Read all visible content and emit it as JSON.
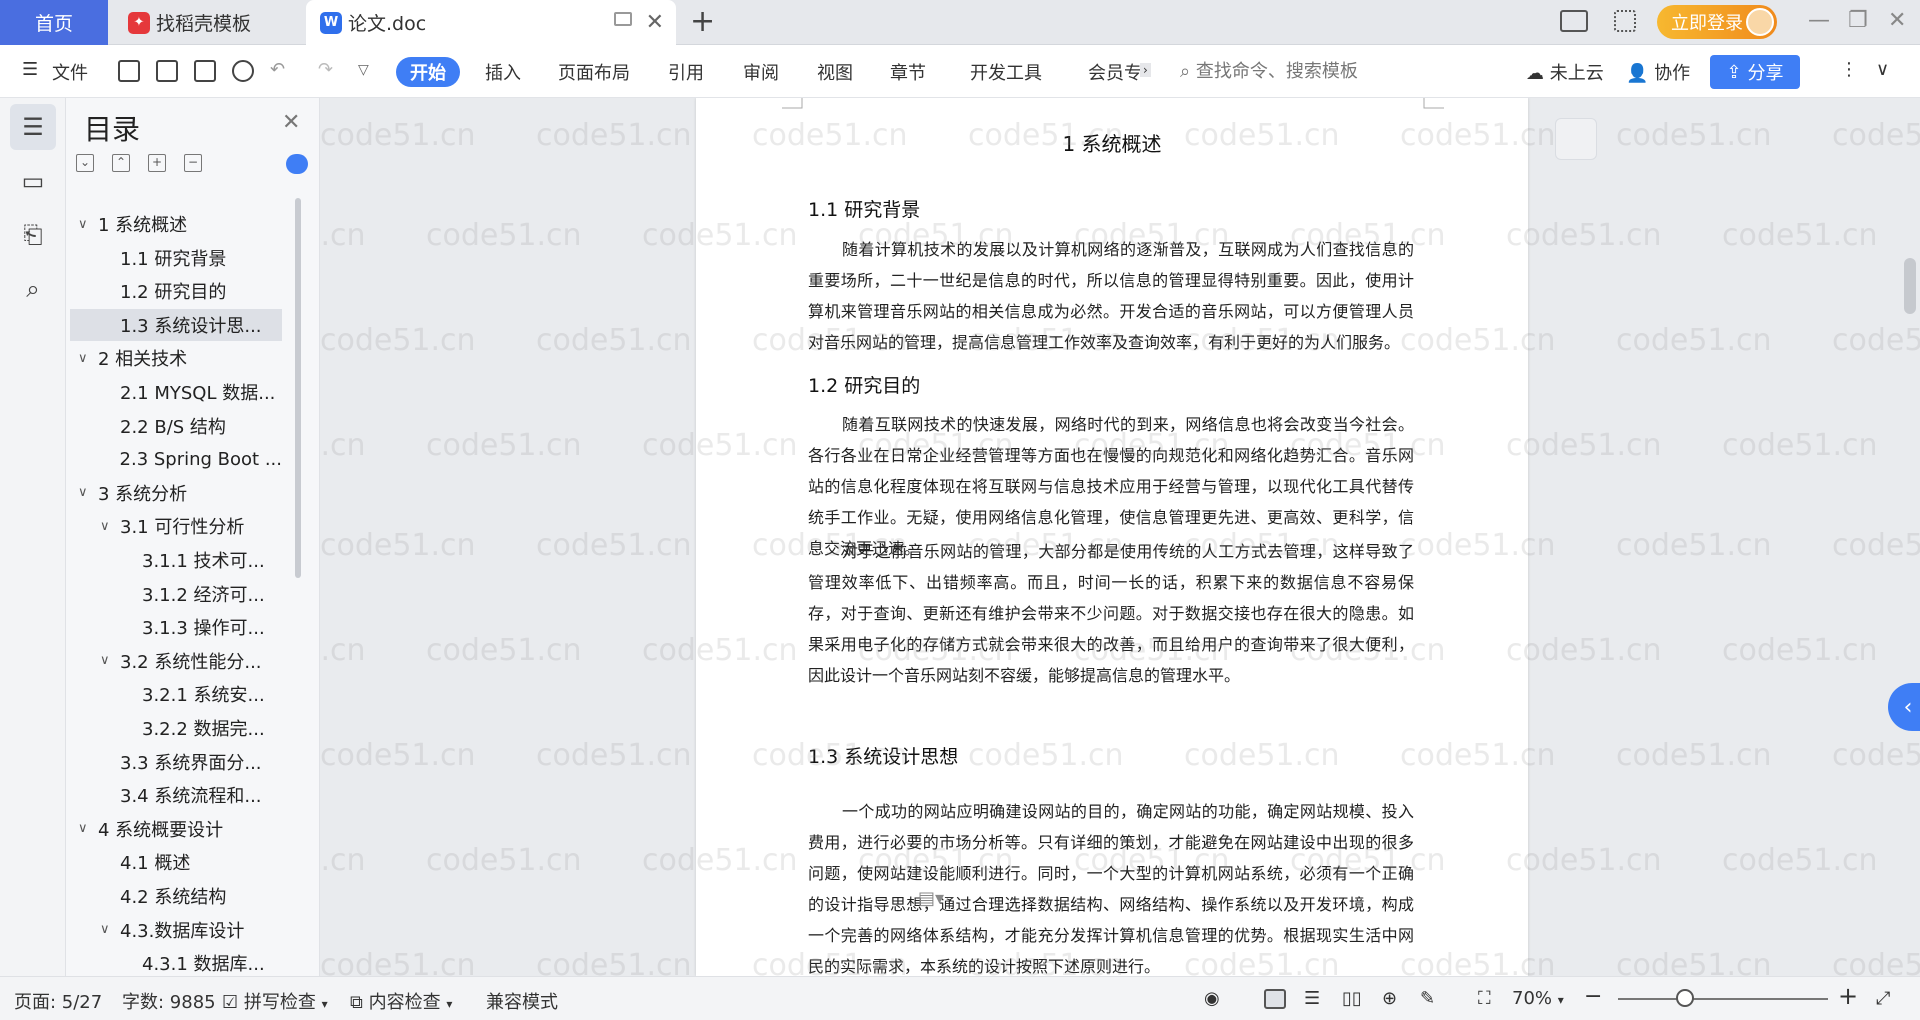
{
  "tabs": {
    "home": "首页",
    "template": "找稻壳模板",
    "doc": "论文.doc",
    "login": "立即登录"
  },
  "ribbon": {
    "file": "文件",
    "start": "开始",
    "menus": [
      "插入",
      "页面布局",
      "引用",
      "审阅",
      "视图",
      "章节",
      "开发工具",
      "会员专"
    ],
    "search_placeholder": "查找命令、搜索模板",
    "cloud": "未上云",
    "collab": "协作",
    "share": "分享"
  },
  "toc": {
    "title": "目录",
    "items": [
      {
        "label": "1 系统概述",
        "level": 0,
        "expanded": true
      },
      {
        "label": "1.1  研究背景",
        "level": 1
      },
      {
        "label": "1.2 研究目的",
        "level": 1
      },
      {
        "label": "1.3 系统设计思...",
        "level": 1,
        "selected": true
      },
      {
        "label": "2 相关技术",
        "level": 0,
        "expanded": true
      },
      {
        "label": "2.1 MYSQL 数据...",
        "level": 1
      },
      {
        "label": "2.2 B/S 结构",
        "level": 1
      },
      {
        "label": "2.3 Spring Boot ...",
        "level": 1
      },
      {
        "label": "3 系统分析",
        "level": 0,
        "expanded": true
      },
      {
        "label": "3.1 可行性分析",
        "level": 1,
        "expanded": true
      },
      {
        "label": "3.1.1 技术可...",
        "level": 2
      },
      {
        "label": "3.1.2 经济可...",
        "level": 2
      },
      {
        "label": "3.1.3 操作可...",
        "level": 2
      },
      {
        "label": "3.2 系统性能分...",
        "level": 1,
        "expanded": true
      },
      {
        "label": "3.2.1  系统安...",
        "level": 2
      },
      {
        "label": "3.2.2  数据完...",
        "level": 2
      },
      {
        "label": "3.3 系统界面分...",
        "level": 1
      },
      {
        "label": "3.4 系统流程和...",
        "level": 1
      },
      {
        "label": "4 系统概要设计",
        "level": 0,
        "expanded": true
      },
      {
        "label": "4.1 概述",
        "level": 1
      },
      {
        "label": "4.2 系统结构",
        "level": 1
      },
      {
        "label": "4.3.数据库设计",
        "level": 1,
        "expanded": true
      },
      {
        "label": "4.3.1 数据库...",
        "level": 2
      }
    ]
  },
  "doc": {
    "chapter_title": "1 系统概述",
    "s1_title": "1.1  研究背景",
    "s1_text": "随着计算机技术的发展以及计算机网络的逐渐普及，互联网成为人们查找信息的重要场所，二十一世纪是信息的时代，所以信息的管理显得特别重要。因此，使用计算机来管理音乐网站的相关信息成为必然。开发合适的音乐网站，可以方便管理人员对音乐网站的管理，提高信息管理工作效率及查询效率，有利于更好的为人们服务。",
    "s2_title": "1.2 研究目的",
    "s2_text1": "随着互联网技术的快速发展，网络时代的到来，网络信息也将会改变当今社会。各行各业在日常企业经营管理等方面也在慢慢的向规范化和网络化趋势汇合。音乐网站的信息化程度体现在将互联网与信息技术应用于经营与管理，以现代化工具代替传统手工作业。无疑，使用网络信息化管理，使信息管理更先进、更高效、更科学，信息交流更迅速。",
    "s2_text2": "对于之前音乐网站的管理，大部分都是使用传统的人工方式去管理，这样导致了管理效率低下、出错频率高。而且，时间一长的话，积累下来的数据信息不容易保存，对于查询、更新还有维护会带来不少问题。对于数据交接也存在很大的隐患。如果采用电子化的存储方式就会带来很大的改善，而且给用户的查询带来了很大便利，因此设计一个音乐网站刻不容缓，能够提高信息的管理水平。",
    "s3_title": "1.3 系统设计思想",
    "s3_text": "一个成功的网站应明确建设网站的目的，确定网站的功能，确定网站规模、投入费用，进行必要的市场分析等。只有详细的策划，才能避免在网站建设中出现的很多问题，使网站建设能顺利进行。同时，一个大型的计算机网站系统，必须有一个正确的设计指导思想，通过合理选择数据结构、网络结构、操作系统以及开发环境，构成一个完善的网络体系结构，才能充分发挥计算机信息管理的优势。根据现实生活中网民的实际需求，本系统的设计按照下述原则进行。",
    "watermark": "code51.cn"
  },
  "status": {
    "page": "页面: 5/27",
    "words": "字数: 9885",
    "spell": "拼写检查",
    "content_check": "内容检查",
    "compat": "兼容模式",
    "zoom": "70%"
  },
  "colors": {
    "accent": "#3f7ef5",
    "home_tab": "#4a6ee0",
    "login": "#f39a22"
  }
}
